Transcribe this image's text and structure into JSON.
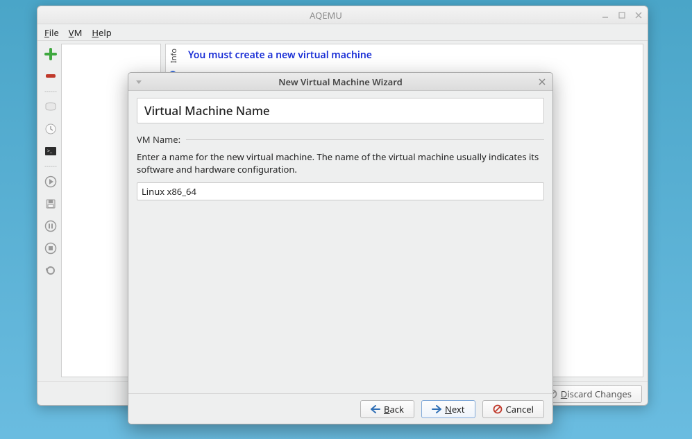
{
  "main_window": {
    "title": "AQEMU",
    "menu": {
      "file": "File",
      "vm": "VM",
      "help": "Help"
    },
    "vm_list": {
      "items": []
    },
    "info": {
      "tab_label": "Info",
      "message": "You must create a new virtual machine"
    },
    "footer": {
      "discard_changes": "Discard Changes"
    }
  },
  "dialog": {
    "title": "New Virtual Machine Wizard",
    "step_heading": "Virtual Machine Name",
    "section_label": "VM Name:",
    "description": "Enter a name for the new virtual machine. The name of the virtual machine usually indicates its software and hardware configuration.",
    "vm_name_value": "Linux x86_64",
    "buttons": {
      "back": "Back",
      "next": "Next",
      "cancel": "Cancel"
    }
  }
}
